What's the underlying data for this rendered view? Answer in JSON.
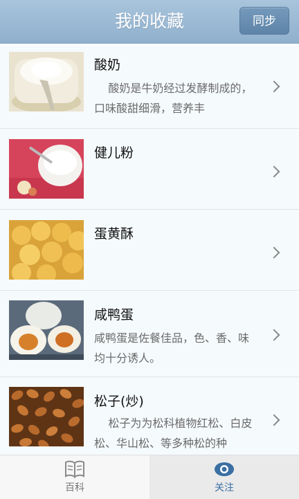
{
  "header": {
    "title": "我的收藏",
    "sync_label": "同步"
  },
  "items": [
    {
      "name": "酸奶",
      "desc": "    酸奶是牛奶经过发酵制成的，口味酸甜细滑，营养丰"
    },
    {
      "name": "健儿粉",
      "desc": ""
    },
    {
      "name": "蛋黄酥",
      "desc": ""
    },
    {
      "name": "咸鸭蛋",
      "desc": "咸鸭蛋是佐餐佳品，色、香、味均十分诱人。"
    },
    {
      "name": "松子(炒)",
      "desc": "    松子为为松科植物红松、白皮松、华山松、等多种松的种"
    }
  ],
  "tabs": [
    {
      "label": "百科",
      "icon": "book-icon",
      "active": false
    },
    {
      "label": "关注",
      "icon": "eye-icon",
      "active": true
    }
  ],
  "colors": {
    "header": "#9db9d4",
    "sync_button": "#6890b4",
    "active_tab_text": "#3a6fa3"
  }
}
